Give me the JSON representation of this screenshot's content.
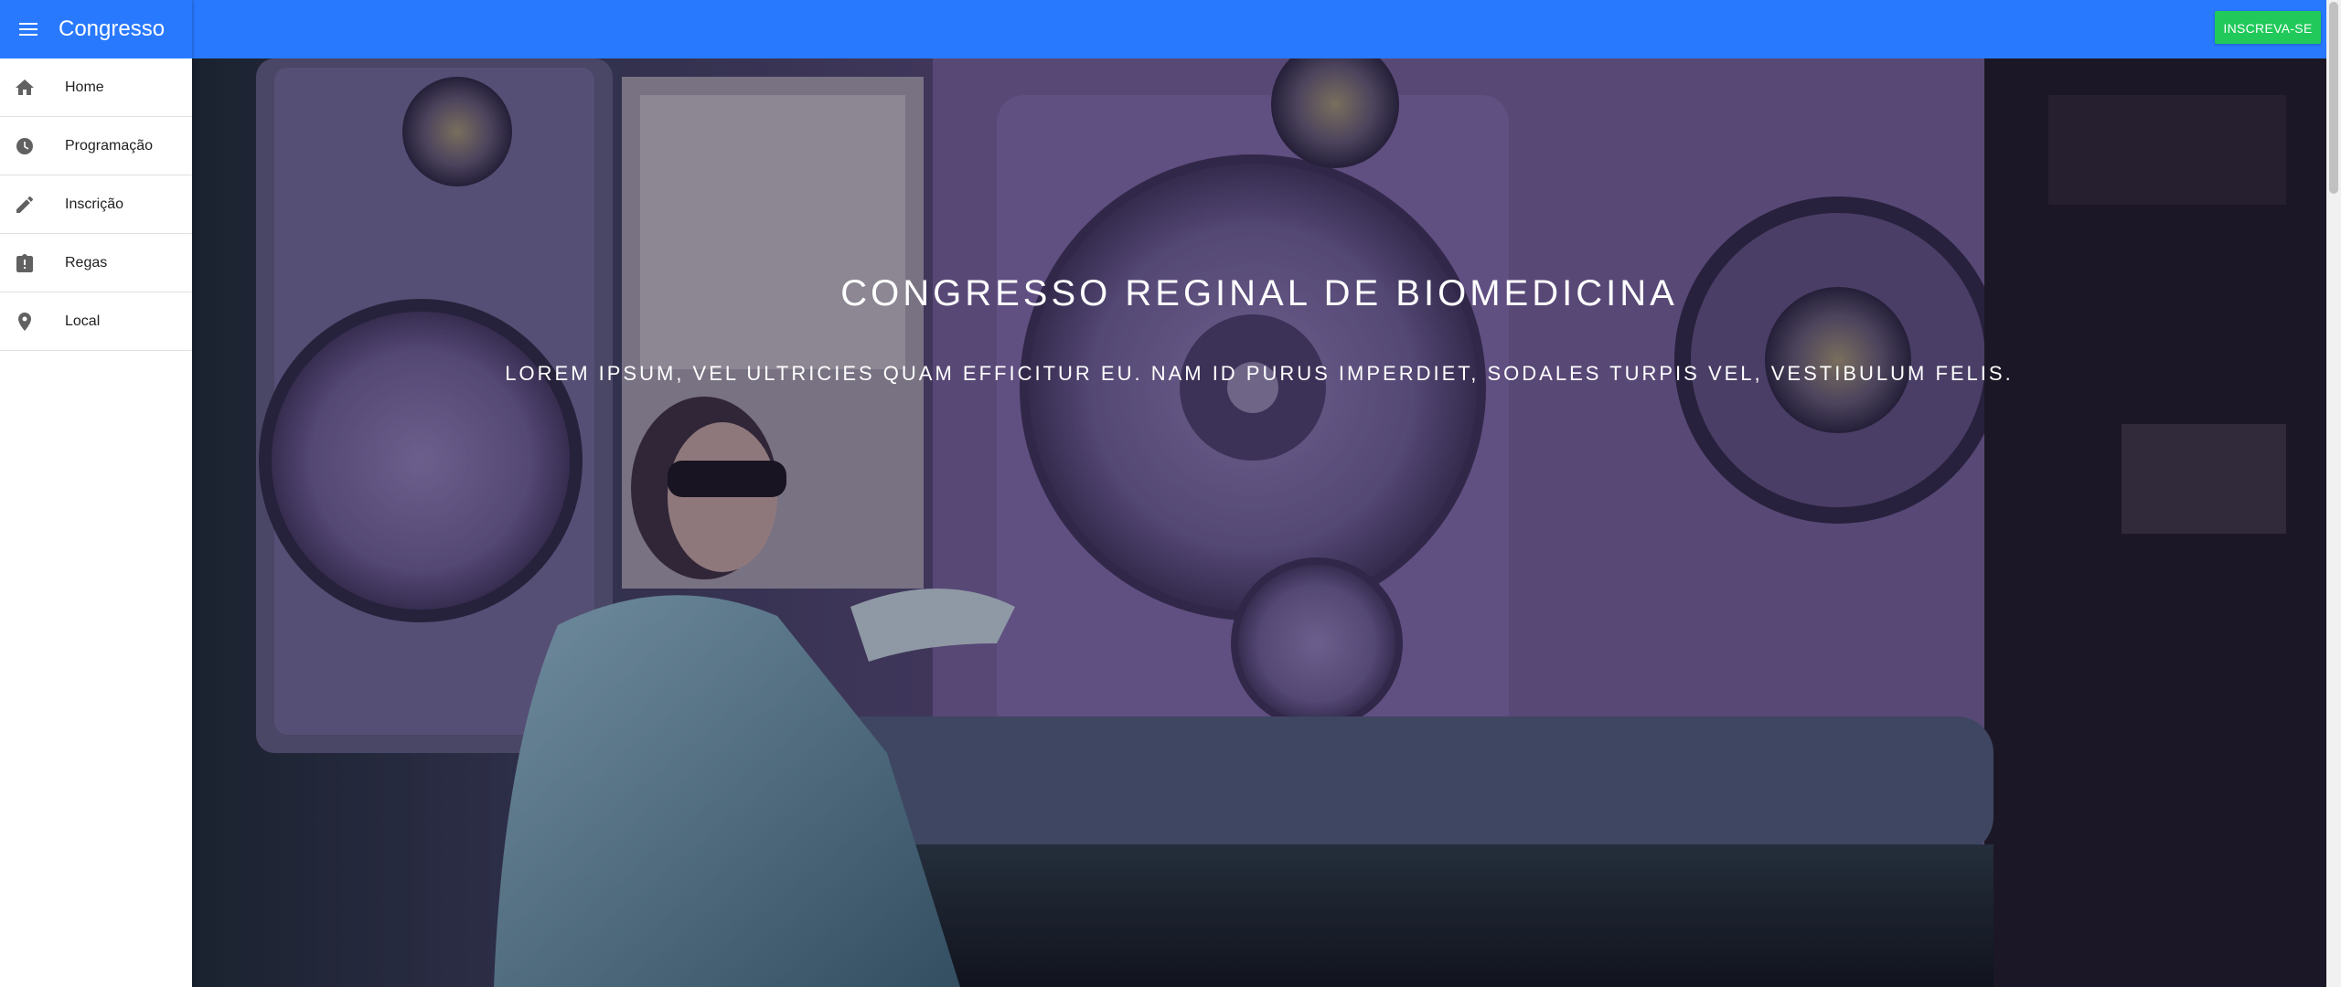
{
  "drawer": {
    "title": "Congresso",
    "menu_icon": "menu-icon",
    "items": [
      {
        "label": "Home",
        "icon": "home-icon"
      },
      {
        "label": "Programação",
        "icon": "clock-icon"
      },
      {
        "label": "Inscrição",
        "icon": "pencil-icon"
      },
      {
        "label": "Regas",
        "icon": "clipboard-alert-icon"
      },
      {
        "label": "Local",
        "icon": "map-pin-icon"
      }
    ]
  },
  "appbar": {
    "signup_label": "INSCREVA-SE"
  },
  "hero": {
    "title": "CONGRESSO REGINAL DE BIOMEDICINA",
    "subtitle": "LOREM IPSUM, VEL ULTRICIES QUAM EFFICITUR EU. NAM ID PURUS IMPERDIET, SODALES TURPIS VEL, VESTIBULUM FELIS."
  },
  "colors": {
    "primary": "#2979ff",
    "accent_button": "#20c95a",
    "nav_text": "#212121"
  }
}
